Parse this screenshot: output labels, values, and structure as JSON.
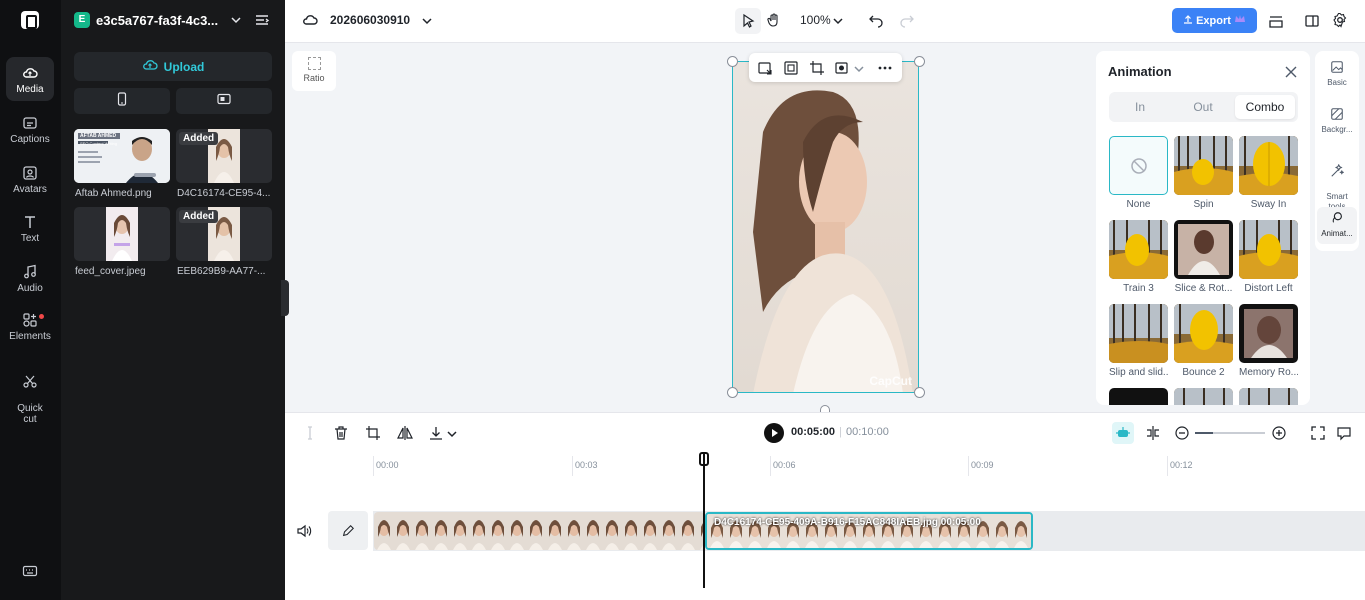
{
  "rail": {
    "items": [
      {
        "label": "Media"
      },
      {
        "label": "Captions"
      },
      {
        "label": "Avatars"
      },
      {
        "label": "Text"
      },
      {
        "label": "Audio"
      },
      {
        "label": "Elements"
      },
      {
        "label": "Quick\ncut"
      }
    ]
  },
  "panel": {
    "project_badge": "E",
    "project_name": "e3c5a767-fa3f-4c3...",
    "upload_label": "Upload",
    "added_label": "Added",
    "media": [
      {
        "name": "Aftab Ahmed.png",
        "added": false
      },
      {
        "name": "D4C16174-CE95-4...",
        "added": true
      },
      {
        "name": "feed_cover.jpeg",
        "added": false
      },
      {
        "name": "EEB629B9-AA77-...",
        "added": true
      }
    ],
    "card_name": "AFTAB AHMED",
    "card_sub": "SEO Content Writing"
  },
  "topbar": {
    "title": "202606030910",
    "zoom": "100%",
    "export_label": "Export"
  },
  "canvas": {
    "ratio_label": "Ratio",
    "watermark": "CapCut"
  },
  "animation": {
    "title": "Animation",
    "tabs": [
      "In",
      "Out",
      "Combo"
    ],
    "active_tab": "Combo",
    "items": [
      {
        "label": "None"
      },
      {
        "label": "Spin"
      },
      {
        "label": "Sway In"
      },
      {
        "label": "Train 3"
      },
      {
        "label": "Slice & Rot..."
      },
      {
        "label": "Distort Left"
      },
      {
        "label": "Slip and slid..."
      },
      {
        "label": "Bounce 2"
      },
      {
        "label": "Memory Ro..."
      }
    ]
  },
  "props": {
    "items": [
      {
        "label": "Basic"
      },
      {
        "label": "Backgr..."
      },
      {
        "label": "Smart\ntools"
      },
      {
        "label": "Animat..."
      }
    ]
  },
  "timeline": {
    "current_time": "00:05:00",
    "separator": "|",
    "total_time": "00:10:00",
    "ruler": [
      "00:00",
      "00:03",
      "00:06",
      "00:09",
      "00:12"
    ],
    "clip_b_label": "D4C16174-CE95-409A-B916-F15AC848IAEB.jpg   00:05:00"
  },
  "colors": {
    "accent": "#2ab8c6",
    "export": "#3b82f6",
    "rail_bg": "#0f1012",
    "panel_bg": "#18191b"
  }
}
